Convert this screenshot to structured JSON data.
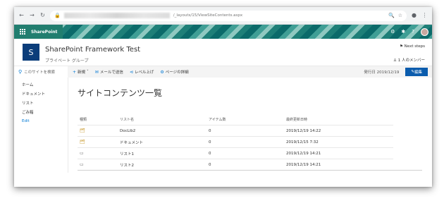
{
  "browser": {
    "url_suffix": "/_layouts/15/ViewSiteContents.aspx"
  },
  "suite": {
    "brand": "SharePoint"
  },
  "site": {
    "logo_letter": "S",
    "title": "SharePoint Framework Test",
    "subtitle": "プライベート グループ",
    "next_steps": "Next steps",
    "members": "1 人のメンバー"
  },
  "search": {
    "placeholder": "このサイトを検索"
  },
  "commands": {
    "new": "新規",
    "email": "メールで送信",
    "promote": "レベル上げ",
    "page_details": "ページの詳細",
    "published": "発行日 2019/12/19",
    "edit": "編集"
  },
  "nav": [
    "ホーム",
    "ドキュメント",
    "リスト",
    "ごみ箱",
    "Edit"
  ],
  "page": {
    "title": "サイトコンテンツ一覧"
  },
  "table": {
    "headers": [
      "種類",
      "リスト名",
      "アイテム数",
      "最終更新日時"
    ],
    "rows": [
      {
        "type_icon": "document-library-icon",
        "name": "DocLib2",
        "count": "0",
        "modified": "2019/12/19 14:22"
      },
      {
        "type_icon": "document-library-icon",
        "name": "ドキュメント",
        "count": "0",
        "modified": "2019/12/15 7:32"
      },
      {
        "type_icon": "list-icon",
        "name": "リスト1",
        "count": "0",
        "modified": "2019/12/19 14:21"
      },
      {
        "type_icon": "list-icon",
        "name": "リスト2",
        "count": "0",
        "modified": "2019/12/19 14:21"
      }
    ]
  }
}
